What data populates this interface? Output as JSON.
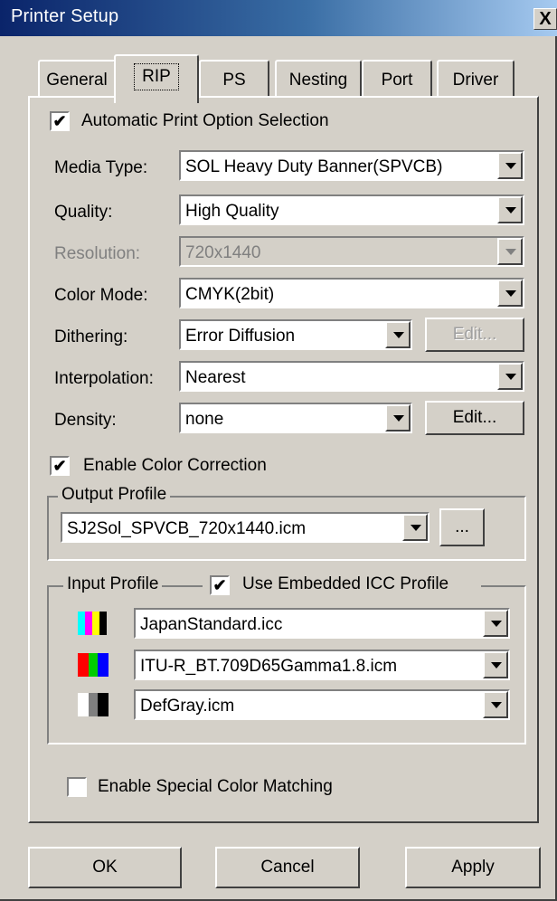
{
  "window": {
    "title": "Printer Setup",
    "close_label": "X"
  },
  "tabs": [
    {
      "label": "General",
      "active": false
    },
    {
      "label": "RIP",
      "active": true
    },
    {
      "label": "PS",
      "active": false
    },
    {
      "label": "Nesting",
      "active": false
    },
    {
      "label": "Port",
      "active": false
    },
    {
      "label": "Driver",
      "active": false
    }
  ],
  "auto_option": {
    "label": "Automatic Print Option Selection",
    "checked": "✔"
  },
  "fields": {
    "media_type": {
      "label": "Media Type:",
      "value": "SOL Heavy Duty Banner(SPVCB)"
    },
    "quality": {
      "label": "Quality:",
      "value": "High Quality"
    },
    "resolution": {
      "label": "Resolution:",
      "value": "720x1440",
      "disabled": true
    },
    "color_mode": {
      "label": "Color Mode:",
      "value": "CMYK(2bit)"
    },
    "dithering": {
      "label": "Dithering:",
      "value": "Error Diffusion",
      "edit_label": "Edit..."
    },
    "interpolation": {
      "label": "Interpolation:",
      "value": "Nearest"
    },
    "density": {
      "label": "Density:",
      "value": "none",
      "edit_label": "Edit..."
    }
  },
  "color_correction": {
    "label": "Enable Color Correction",
    "checked": "✔"
  },
  "output_profile": {
    "legend": "Output Profile",
    "value": "SJ2Sol_SPVCB_720x1440.icm",
    "browse_label": "..."
  },
  "input_profile": {
    "legend": "Input Profile",
    "embedded_label": "Use Embedded ICC Profile",
    "embedded_checked": "✔",
    "rows": [
      {
        "icon": "cmyk-icon",
        "value": "JapanStandard.icc",
        "colors": [
          "#00ffff",
          "#ff00ff",
          "#ffff00",
          "#000000"
        ]
      },
      {
        "icon": "rgb-icon",
        "value": "ITU-R_BT.709D65Gamma1.8.icm",
        "colors": [
          "#ff0000",
          "#00cc00",
          "#0000ff"
        ]
      },
      {
        "icon": "gray-icon",
        "value": "DefGray.icm",
        "colors": [
          "#ffffff",
          "#808080",
          "#000000"
        ]
      }
    ]
  },
  "special_color": {
    "label": "Enable Special Color Matching",
    "checked": ""
  },
  "buttons": {
    "ok": "OK",
    "cancel": "Cancel",
    "apply": "Apply"
  }
}
